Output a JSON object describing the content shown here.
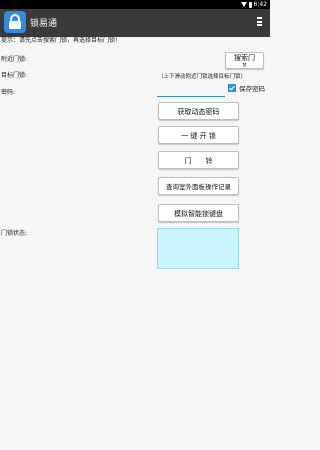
{
  "status_bar": {
    "time": "6:42"
  },
  "app_bar": {
    "title": "锁易通"
  },
  "hint": {
    "text": "提示：请先点击搜索门锁，再选择目标门锁!"
  },
  "nearby_label": "附近门锁:",
  "search_button": {
    "line1": "搜索门",
    "line2": "锁"
  },
  "target_label": "目标门锁:",
  "target_note": "（上下滑动附近门锁选择目标门锁）",
  "password_label": "密码:",
  "password_value": "",
  "save_password": {
    "label": "保存密码",
    "checked": true
  },
  "buttons": {
    "get_dynamic_password": "获取动态密码",
    "one_key_unlock": "一 键 开 锁",
    "doorbell": "门　　铃",
    "query_panel_records": "查询室外面板操作记录",
    "simulate_keypad": "模拟智能锁键盘"
  },
  "lock_status_label": "门锁状态:",
  "lock_status_value": "",
  "colors": {
    "accent": "#2f8de4",
    "app_bar": "#3a3a3a",
    "status_box": "#ccf5ff"
  },
  "icons": [
    "wifi-icon",
    "battery-icon",
    "app-lock-icon",
    "overflow-menu-icon",
    "checkmark-icon"
  ]
}
